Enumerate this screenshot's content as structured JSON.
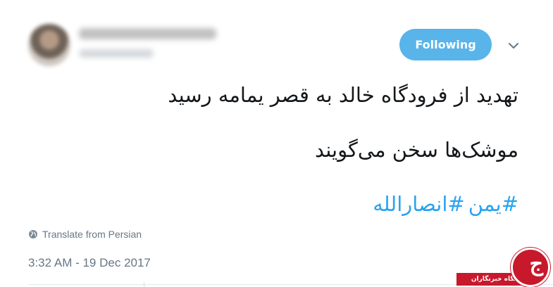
{
  "header": {
    "follow_label": "Following",
    "caret_icon": "chevron-down-icon"
  },
  "tweet": {
    "line1": "تهدید از فرودگاه خالد به قصر یمامه رسید",
    "line2": "موشک‌ها سخن می‌گویند",
    "hashtags": [
      "#یمن",
      "#انصارالله"
    ]
  },
  "footer": {
    "translate_label": "Translate from Persian",
    "timestamp": "3:32 AM - 19 Dec 2017"
  },
  "watermark": {
    "glyph": "ج",
    "text": "باشگاه خبرنگاران"
  },
  "colors": {
    "accent": "#59b4ea",
    "hashtag": "#2aa3ef",
    "muted": "#657786",
    "watermark": "#c8182b"
  }
}
